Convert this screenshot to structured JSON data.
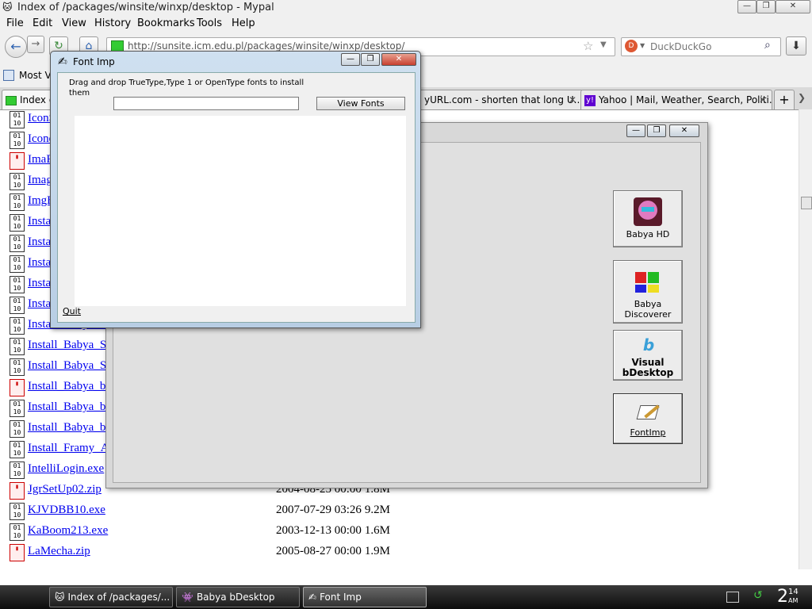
{
  "browser": {
    "window_title": "Index of /packages/winsite/winxp/desktop - Mypal",
    "menu": [
      "File",
      "Edit",
      "View",
      "History",
      "Bookmarks",
      "Tools",
      "Help"
    ],
    "url": "http://sunsite.icm.edu.pl/packages/winsite/winxp/desktop/",
    "search_placeholder": "DuckDuckGo",
    "bookmarks_label": "Most Vi",
    "tabs": [
      {
        "label": "Index of"
      },
      {
        "label": "yURL.com - shorten that long U..."
      },
      {
        "label": "Yahoo | Mail, Weather, Search, Politi..."
      }
    ]
  },
  "listing": [
    {
      "name": "IconS",
      "date": "",
      "size": "",
      "type": "exe"
    },
    {
      "name": "Icono",
      "date": "",
      "size": "",
      "type": "exe"
    },
    {
      "name": "ImaR",
      "date": "",
      "size": "",
      "type": "zip"
    },
    {
      "name": "Image",
      "date": "",
      "size": "",
      "type": "exe"
    },
    {
      "name": "ImgB",
      "date": "",
      "size": "",
      "type": "exe"
    },
    {
      "name": "Install",
      "date": "",
      "size": "",
      "type": "exe"
    },
    {
      "name": "Install",
      "date": "",
      "size": "",
      "type": "exe"
    },
    {
      "name": "Install",
      "date": "",
      "size": "",
      "type": "exe"
    },
    {
      "name": "Install",
      "date": "",
      "size": "",
      "type": "exe"
    },
    {
      "name": "Install",
      "date": "",
      "size": "",
      "type": "exe"
    },
    {
      "name": "Install_Babya_Sy",
      "date": "",
      "size": "",
      "type": "exe"
    },
    {
      "name": "Install_Babya_Sy",
      "date": "",
      "size": "",
      "type": "exe"
    },
    {
      "name": "Install_Babya_Sy",
      "date": "",
      "size": "",
      "type": "exe"
    },
    {
      "name": "Install_Babya_bC",
      "date": "",
      "size": "",
      "type": "zip"
    },
    {
      "name": "Install_Babya_bS",
      "date": "",
      "size": "",
      "type": "exe"
    },
    {
      "name": "Install_Babya_bS",
      "date": "",
      "size": "",
      "type": "exe"
    },
    {
      "name": "Install_Framy_Ar",
      "date": "",
      "size": "",
      "type": "exe"
    },
    {
      "name": "IntelliLogin.exe",
      "date": "",
      "size": "",
      "type": "exe"
    },
    {
      "name": "JgrSetUp02.zip",
      "date": "2004-08-25 00:00",
      "size": "1.8M",
      "type": "zip"
    },
    {
      "name": "KJVDBB10.exe",
      "date": "2007-07-29 03:26",
      "size": "9.2M",
      "type": "exe"
    },
    {
      "name": "KaBoom213.exe",
      "date": "2003-12-13 00:00",
      "size": "1.6M",
      "type": "exe"
    },
    {
      "name": "LaMecha.zip",
      "date": "2005-08-27 00:00",
      "size": "1.9M",
      "type": "zip"
    }
  ],
  "bdesktop": {
    "buttons": [
      {
        "label": "Babya HD"
      },
      {
        "label": "Babya Discoverer"
      },
      {
        "label": "Visual bDesktop"
      },
      {
        "label": "FontImp"
      }
    ]
  },
  "fontimp": {
    "title": "Font Imp",
    "instructions": "Drag and drop TrueType,Type 1 or OpenType fonts to install them",
    "input_value": "",
    "view_fonts_label": "View Fonts",
    "quit_label": "Quit"
  },
  "taskbar": {
    "tasks": [
      {
        "label": "Index of /packages/..."
      },
      {
        "label": "Babya bDesktop"
      },
      {
        "label": "Font Imp"
      }
    ],
    "clock_hour": "2",
    "clock_min": "14",
    "clock_ampm": "AM"
  },
  "colors": {
    "link": "#0000ee",
    "taskbar": "#1a1a1a",
    "fontimp_frame": "#c4d6ea"
  }
}
